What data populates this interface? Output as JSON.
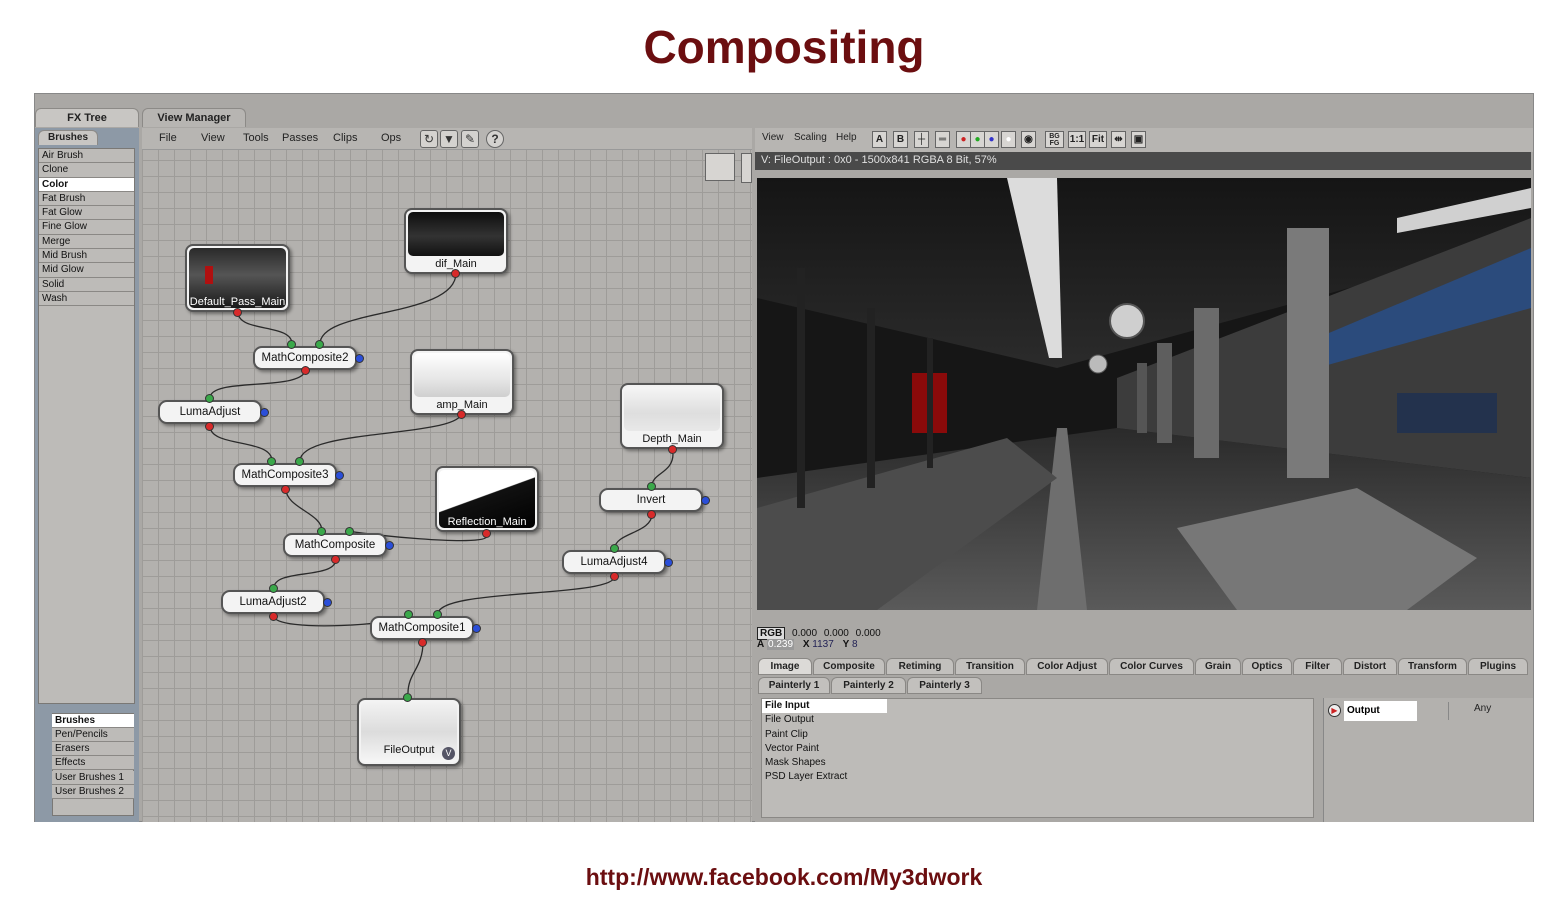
{
  "slide": {
    "title": "Compositing",
    "footer_url": "http://www.facebook.com/My3dwork"
  },
  "tabs": {
    "fx_tree": "FX Tree",
    "view_manager": "View Manager"
  },
  "left_panel": {
    "header": "Brushes",
    "brushes": [
      "Air Brush",
      "Clone",
      "Color",
      "Fat Brush",
      "Fat Glow",
      "Fine Glow",
      "Merge",
      "Mid Brush",
      "Mid Glow",
      "Solid",
      "Wash"
    ],
    "selected_brush": "Color",
    "categories": [
      "Brushes",
      "Pen/Pencils",
      "Erasers",
      "Effects",
      "User Brushes 1",
      "User Brushes 2"
    ],
    "selected_category": "Brushes"
  },
  "node_menu": {
    "items": [
      "File",
      "View",
      "Tools",
      "Passes",
      "Clips",
      "Ops"
    ],
    "help_icon": "?"
  },
  "nodes": {
    "default_pass": "Default_Pass_Main",
    "dif": "dif_Main",
    "math2": "MathComposite2",
    "amp": "amp_Main",
    "luma": "LumaAdjust",
    "depth": "Depth_Main",
    "math3": "MathComposite3",
    "reflection": "Reflection_Main",
    "invert": "Invert",
    "math": "MathComposite",
    "luma4": "LumaAdjust4",
    "luma2": "LumaAdjust2",
    "math1": "MathComposite1",
    "output": "FileOutput",
    "output_badge": "V"
  },
  "viewer": {
    "menu": [
      "View",
      "Scaling",
      "Help"
    ],
    "toolbar": {
      "a": "A",
      "b": "B",
      "ratio": "1:1",
      "fit": "Fit",
      "bg": "BG FG"
    },
    "info": "V: FileOutput : 0x0 - 1500x841 RGBA 8 Bit, 57%",
    "readout": {
      "rgb_label": "RGB",
      "r": "0.000",
      "g": "0.000",
      "b": "0.000",
      "a_label": "A",
      "a_value": "0.239",
      "x_label": "X",
      "x_value": "1137",
      "y_label": "Y",
      "y_value": "8"
    }
  },
  "prop_tabs": {
    "row1": [
      "Image",
      "Composite",
      "Retiming",
      "Transition",
      "Color Adjust",
      "Color Curves",
      "Grain",
      "Optics",
      "Filter",
      "Distort",
      "Transform",
      "Plugins"
    ],
    "row2": [
      "Painterly 1",
      "Painterly 2",
      "Painterly 3"
    ],
    "selected": "Image"
  },
  "image_list": {
    "items": [
      "File Input",
      "File Output",
      "Paint Clip",
      "Vector Paint",
      "Mask Shapes",
      "PSD Layer Extract"
    ],
    "selected": "File Input"
  },
  "output_panel": {
    "label": "Output",
    "value": "Any"
  },
  "colors": {
    "title_red": "#6b0e10",
    "port_green": "#3aa84a",
    "port_red": "#d82a2a",
    "port_blue": "#2a4ed8"
  }
}
